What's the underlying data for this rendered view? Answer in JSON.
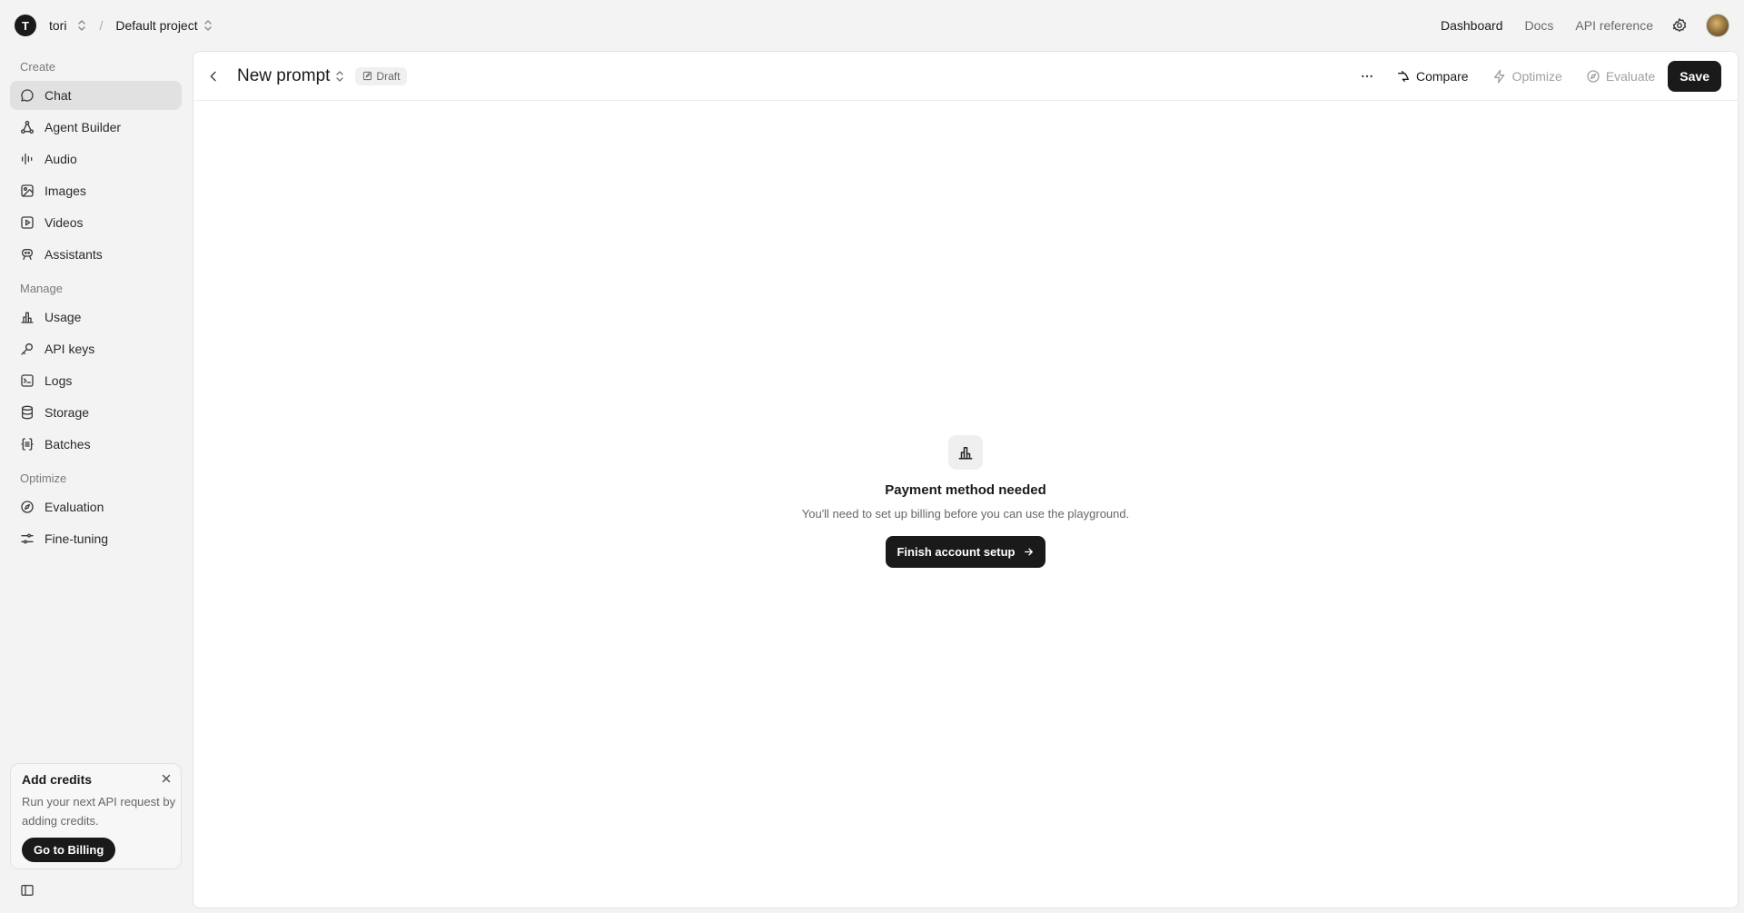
{
  "topbar": {
    "org_initial": "T",
    "org_name": "tori",
    "separator": "/",
    "project_name": "Default project",
    "nav": [
      {
        "label": "Dashboard",
        "active": true
      },
      {
        "label": "Docs",
        "active": false
      },
      {
        "label": "API reference",
        "active": false
      }
    ]
  },
  "sidebar": {
    "sections": {
      "create": "Create",
      "manage": "Manage",
      "optimize": "Optimize"
    },
    "items": [
      {
        "label": "Chat",
        "icon": "chat-bubble-icon",
        "active": true
      },
      {
        "label": "Agent Builder",
        "icon": "agent-builder-icon"
      },
      {
        "label": "Audio",
        "icon": "audio-waveform-icon"
      },
      {
        "label": "Images",
        "icon": "image-icon"
      },
      {
        "label": "Videos",
        "icon": "video-play-icon"
      },
      {
        "label": "Assistants",
        "icon": "assistant-robot-icon"
      },
      {
        "label": "Usage",
        "icon": "bar-chart-icon"
      },
      {
        "label": "API keys",
        "icon": "key-icon"
      },
      {
        "label": "Logs",
        "icon": "terminal-log-icon"
      },
      {
        "label": "Storage",
        "icon": "database-icon"
      },
      {
        "label": "Batches",
        "icon": "braces-icon"
      },
      {
        "label": "Evaluation",
        "icon": "compass-icon"
      },
      {
        "label": "Fine-tuning",
        "icon": "sliders-icon"
      }
    ],
    "credits": {
      "title": "Add credits",
      "body": "Run your next API request by adding credits.",
      "button": "Go to Billing"
    }
  },
  "main": {
    "title": "New prompt",
    "badge": "Draft",
    "actions": {
      "compare": "Compare",
      "optimize": "Optimize",
      "evaluate": "Evaluate",
      "save": "Save"
    },
    "empty_state": {
      "title": "Payment method needed",
      "body": "You'll need to set up billing before you can use the playground.",
      "button": "Finish account setup"
    }
  }
}
